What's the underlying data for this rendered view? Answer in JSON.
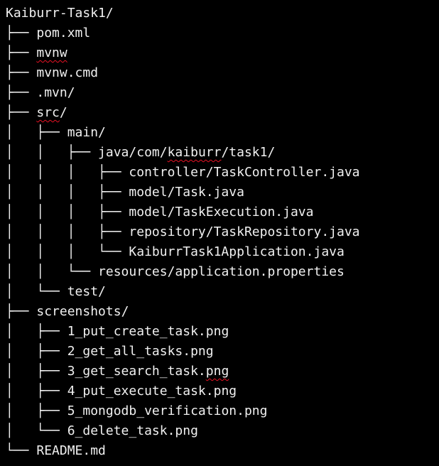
{
  "tree": {
    "lines": [
      {
        "prefix": "",
        "parts": [
          {
            "text": "Kaiburr-Task1/",
            "squiggle": false
          }
        ]
      },
      {
        "prefix": "├── ",
        "parts": [
          {
            "text": "pom.xml",
            "squiggle": false
          }
        ]
      },
      {
        "prefix": "├── ",
        "parts": [
          {
            "text": "mvnw",
            "squiggle": true
          }
        ]
      },
      {
        "prefix": "├── ",
        "parts": [
          {
            "text": "mvnw.cmd",
            "squiggle": false
          }
        ]
      },
      {
        "prefix": "├── ",
        "parts": [
          {
            "text": ".mvn/",
            "squiggle": false
          }
        ]
      },
      {
        "prefix": "├── ",
        "parts": [
          {
            "text": "src",
            "squiggle": true
          },
          {
            "text": "/",
            "squiggle": false
          }
        ]
      },
      {
        "prefix": "│   ├── ",
        "parts": [
          {
            "text": "main/",
            "squiggle": false
          }
        ]
      },
      {
        "prefix": "│   │   ├── ",
        "parts": [
          {
            "text": "java/com/",
            "squiggle": false
          },
          {
            "text": "kaiburr",
            "squiggle": true
          },
          {
            "text": "/task1/",
            "squiggle": false
          }
        ]
      },
      {
        "prefix": "│   │   │   ├── ",
        "parts": [
          {
            "text": "controller/TaskController.java",
            "squiggle": false
          }
        ]
      },
      {
        "prefix": "│   │   │   ├── ",
        "parts": [
          {
            "text": "model/Task.java",
            "squiggle": false
          }
        ]
      },
      {
        "prefix": "│   │   │   ├── ",
        "parts": [
          {
            "text": "model/TaskExecution.java",
            "squiggle": false
          }
        ]
      },
      {
        "prefix": "│   │   │   ├── ",
        "parts": [
          {
            "text": "repository/TaskRepository.java",
            "squiggle": false
          }
        ]
      },
      {
        "prefix": "│   │   │   └── ",
        "parts": [
          {
            "text": "KaiburrTask1Application.java",
            "squiggle": false
          }
        ]
      },
      {
        "prefix": "│   │   └── ",
        "parts": [
          {
            "text": "resources/application.properties",
            "squiggle": false
          }
        ]
      },
      {
        "prefix": "│   └── ",
        "parts": [
          {
            "text": "test/",
            "squiggle": false
          }
        ]
      },
      {
        "prefix": "├── ",
        "parts": [
          {
            "text": "screenshots/",
            "squiggle": false
          }
        ]
      },
      {
        "prefix": "│   ├── ",
        "parts": [
          {
            "text": "1_put_create_task.png",
            "squiggle": false
          }
        ]
      },
      {
        "prefix": "│   ├── ",
        "parts": [
          {
            "text": "2_get_all_tasks.png",
            "squiggle": false
          }
        ]
      },
      {
        "prefix": "│   ├── ",
        "parts": [
          {
            "text": "3_get_search_task.",
            "squiggle": false
          },
          {
            "text": "png",
            "squiggle": true
          }
        ]
      },
      {
        "prefix": "│   ├── ",
        "parts": [
          {
            "text": "4_put_execute_task.png",
            "squiggle": false
          }
        ]
      },
      {
        "prefix": "│   ├── ",
        "parts": [
          {
            "text": "5_mongodb_verification.png",
            "squiggle": false
          }
        ]
      },
      {
        "prefix": "│   └── ",
        "parts": [
          {
            "text": "6_delete_task.png",
            "squiggle": false
          }
        ]
      },
      {
        "prefix": "└── ",
        "parts": [
          {
            "text": "README.md",
            "squiggle": false
          }
        ]
      }
    ]
  }
}
